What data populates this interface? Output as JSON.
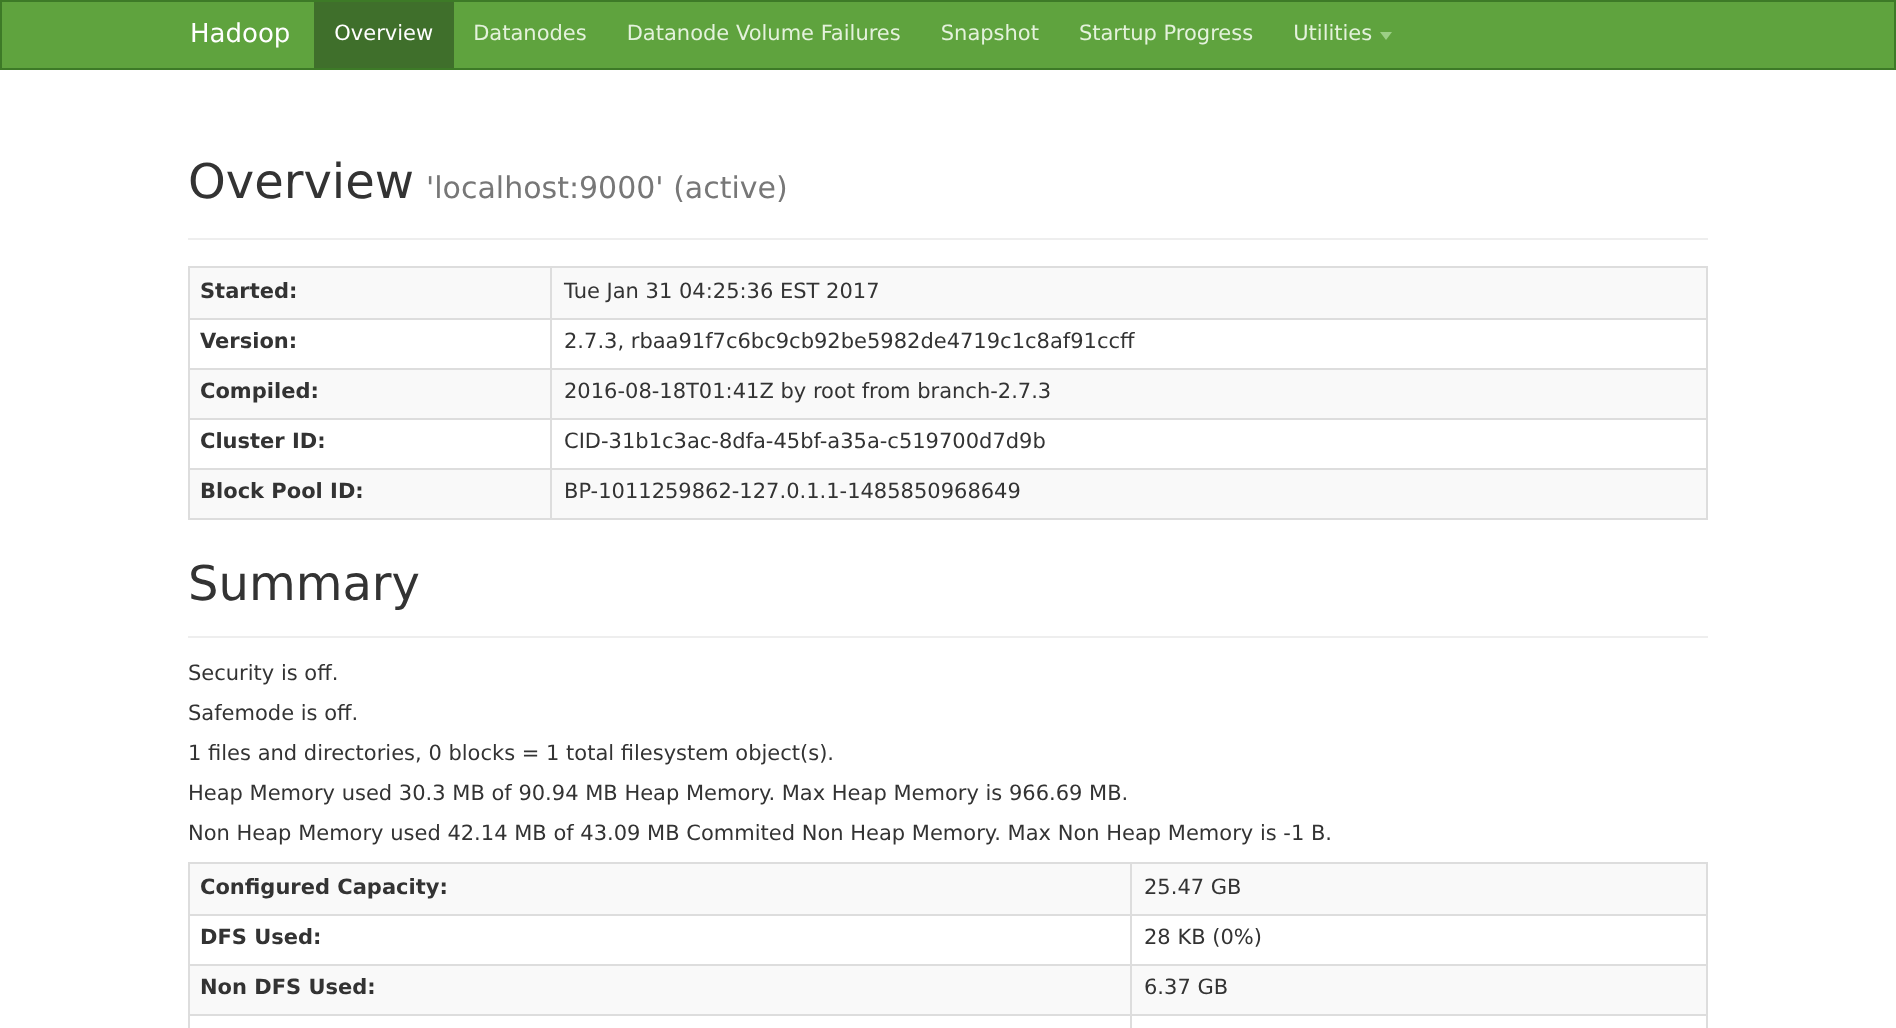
{
  "navbar": {
    "brand": "Hadoop",
    "items": [
      {
        "label": "Overview",
        "selected": true,
        "dropdown": false
      },
      {
        "label": "Datanodes",
        "selected": false,
        "dropdown": false
      },
      {
        "label": "Datanode Volume Failures",
        "selected": false,
        "dropdown": false
      },
      {
        "label": "Snapshot",
        "selected": false,
        "dropdown": false
      },
      {
        "label": "Startup Progress",
        "selected": false,
        "dropdown": false
      },
      {
        "label": "Utilities",
        "selected": false,
        "dropdown": true
      }
    ]
  },
  "overview": {
    "title": "Overview",
    "subtitle": "'localhost:9000' (active)",
    "rows": [
      {
        "label": "Started:",
        "value": "Tue Jan 31 04:25:36 EST 2017"
      },
      {
        "label": "Version:",
        "value": "2.7.3, rbaa91f7c6bc9cb92be5982de4719c1c8af91ccff"
      },
      {
        "label": "Compiled:",
        "value": "2016-08-18T01:41Z by root from branch-2.7.3"
      },
      {
        "label": "Cluster ID:",
        "value": "CID-31b1c3ac-8dfa-45bf-a35a-c519700d7d9b"
      },
      {
        "label": "Block Pool ID:",
        "value": "BP-1011259862-127.0.1.1-1485850968649"
      }
    ]
  },
  "summary": {
    "title": "Summary",
    "lines": [
      "Security is off.",
      "Safemode is off.",
      "1 files and directories, 0 blocks = 1 total filesystem object(s).",
      "Heap Memory used 30.3 MB of 90.94 MB Heap Memory. Max Heap Memory is 966.69 MB.",
      "Non Heap Memory used 42.14 MB of 43.09 MB Commited Non Heap Memory. Max Non Heap Memory is -1 B."
    ],
    "rows": [
      {
        "label": "Configured Capacity:",
        "value": "25.47 GB"
      },
      {
        "label": "DFS Used:",
        "value": "28 KB (0%)"
      },
      {
        "label": "Non DFS Used:",
        "value": "6.37 GB"
      }
    ]
  }
}
